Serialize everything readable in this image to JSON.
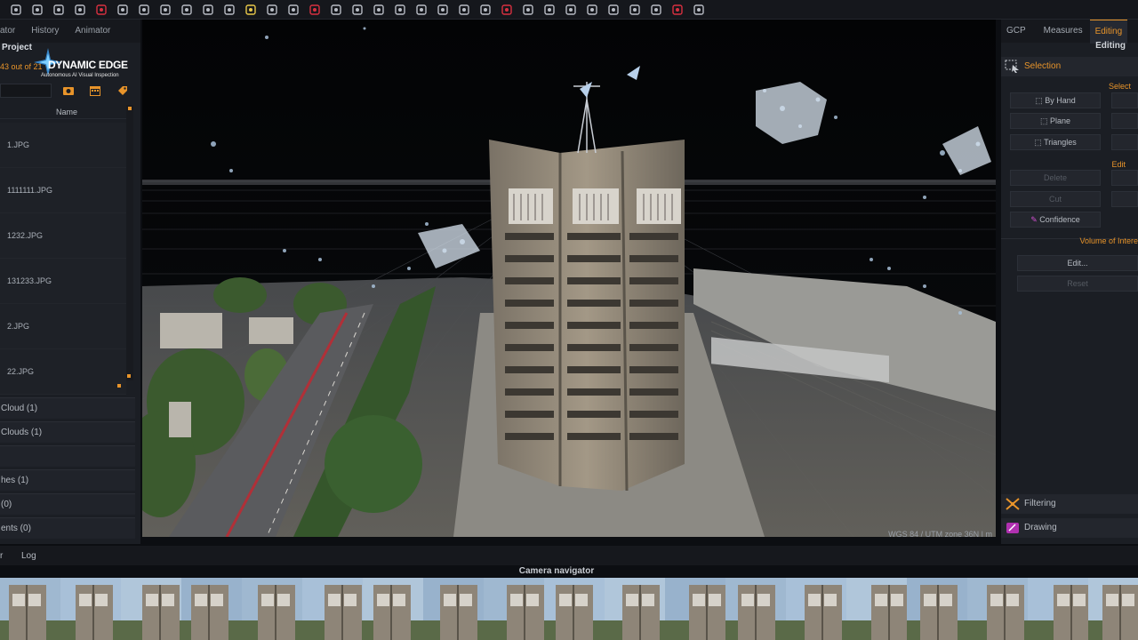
{
  "toolbar": {
    "icons": [
      "cube-icon",
      "cube-icon",
      "dots-icon",
      "network-icon",
      "cube-red-icon",
      "sphere-icon",
      "network-icon",
      "camera-icon",
      "rotate-icon",
      "rotate-cw-icon",
      "image-icon",
      "bulb-icon",
      "triangle-icon",
      "triangle-icon",
      "triangle-red-icon",
      "brush-icon",
      "gear-icon",
      "dots-icon",
      "dots-icon",
      "cube-outline-icon",
      "cube-color-icon",
      "box-icon",
      "undo-icon",
      "redo-icon",
      "transform-icon",
      "circle-icon",
      "pen-icon",
      "ruler-icon",
      "flag-icon",
      "measure-icon",
      "cube-outline-icon",
      "cube-red-icon",
      "help-icon"
    ]
  },
  "left_panel": {
    "tabs": [
      "ator",
      "History",
      "Animator"
    ],
    "project_label": "Project",
    "image_count": "43 out of 21",
    "logo": {
      "main": "DYNAMIC EDGE",
      "sub": "Autonomous AI Visual Inspection"
    },
    "name_header": "Name",
    "images": [
      "1.JPG",
      "1111111.JPG",
      "1232.JPG",
      "131233.JPG",
      "2.JPG",
      "22.JPG"
    ],
    "sections": [
      "Cloud (1)",
      "Clouds (1)",
      "",
      "hes (1)",
      "(0)",
      "ents (0)"
    ]
  },
  "viewport": {
    "coord_system": "WGS 84 / UTM zone 36N | m"
  },
  "right_panel": {
    "tabs": [
      "GCP",
      "Measures",
      "Editing"
    ],
    "active_tab": "Editing",
    "title": "Editing",
    "selection_label": "Selection",
    "select_group": "Select",
    "select_buttons": [
      "By Hand",
      "Plane",
      "Triangles"
    ],
    "edit_group": "Edit",
    "edit_buttons": [
      "Delete",
      "Cut",
      "Confidence"
    ],
    "voi_group": "Volume of Intere",
    "voi_buttons": [
      "Edit...",
      "Reset"
    ],
    "filtering_label": "Filtering",
    "drawing_label": "Drawing"
  },
  "bottom": {
    "tabs": [
      "r",
      "Log"
    ],
    "camera_navigator": "Camera navigator"
  },
  "colors": {
    "accent": "#e8942a",
    "panel": "#1b1e24",
    "viewport": "#050608"
  }
}
